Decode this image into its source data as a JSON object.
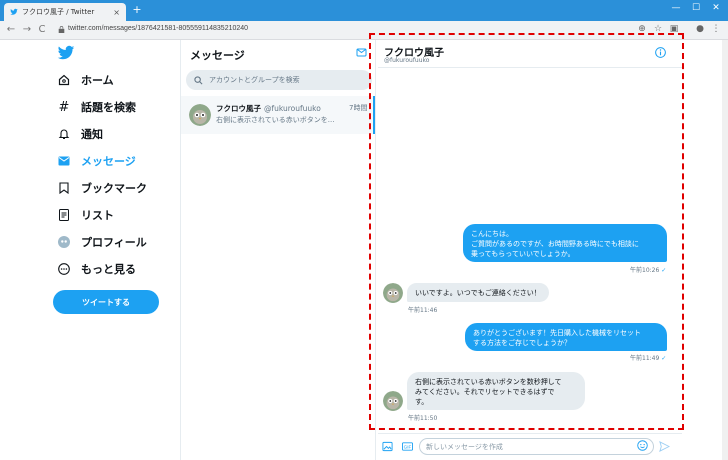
{
  "browser": {
    "tab_title": "フクロウ風子 / Twitter",
    "tab_close": "×",
    "new_tab": "+",
    "url": "twitter.com/messages/1876421581-805559114835210240",
    "win_min": "—",
    "win_max": "☐",
    "win_close": "✕",
    "back": "←",
    "forward": "→",
    "reload": "C",
    "home": "⌂"
  },
  "sidebar": {
    "items": [
      {
        "label": "ホーム"
      },
      {
        "label": "話題を検索"
      },
      {
        "label": "通知"
      },
      {
        "label": "メッセージ"
      },
      {
        "label": "ブックマーク"
      },
      {
        "label": "リスト"
      },
      {
        "label": "プロフィール"
      },
      {
        "label": "もっと見る"
      }
    ],
    "tweet_button": "ツイートする"
  },
  "messages": {
    "title": "メッセージ",
    "search_placeholder": "アカウントとグループを検索",
    "conversation": {
      "name": "フクロウ風子",
      "handle": "@fukuroufuuko",
      "time": "7時間",
      "preview": "右側に表示されている赤いボタンを..."
    }
  },
  "chat": {
    "name": "フクロウ風子",
    "handle": "@fukuroufuuko",
    "messages": [
      {
        "lines": [
          "こんにちは。",
          "ご質問があるのですが、お時間野ある時にでも相談に",
          "乗ってもらっていいでしょうか。"
        ],
        "time": "午前10:26"
      },
      {
        "lines": [
          "いいですよ。いつでもご連絡ください！"
        ],
        "time": "午前11:46"
      },
      {
        "lines": [
          "ありがとうございます！先日購入した機械をリセット",
          "する方法をご存じでしょうか？"
        ],
        "time": "午前11:49"
      },
      {
        "lines": [
          "右側に表示されている赤いボタンを数秒押して",
          "みてください。それでリセットできるはずで",
          "す。"
        ],
        "time": "午前11:50"
      }
    ],
    "read_mark": "✓",
    "compose_placeholder": "新しいメッセージを作成"
  },
  "colors": {
    "accent": "#1da1f2",
    "highlight": "#e00000"
  }
}
